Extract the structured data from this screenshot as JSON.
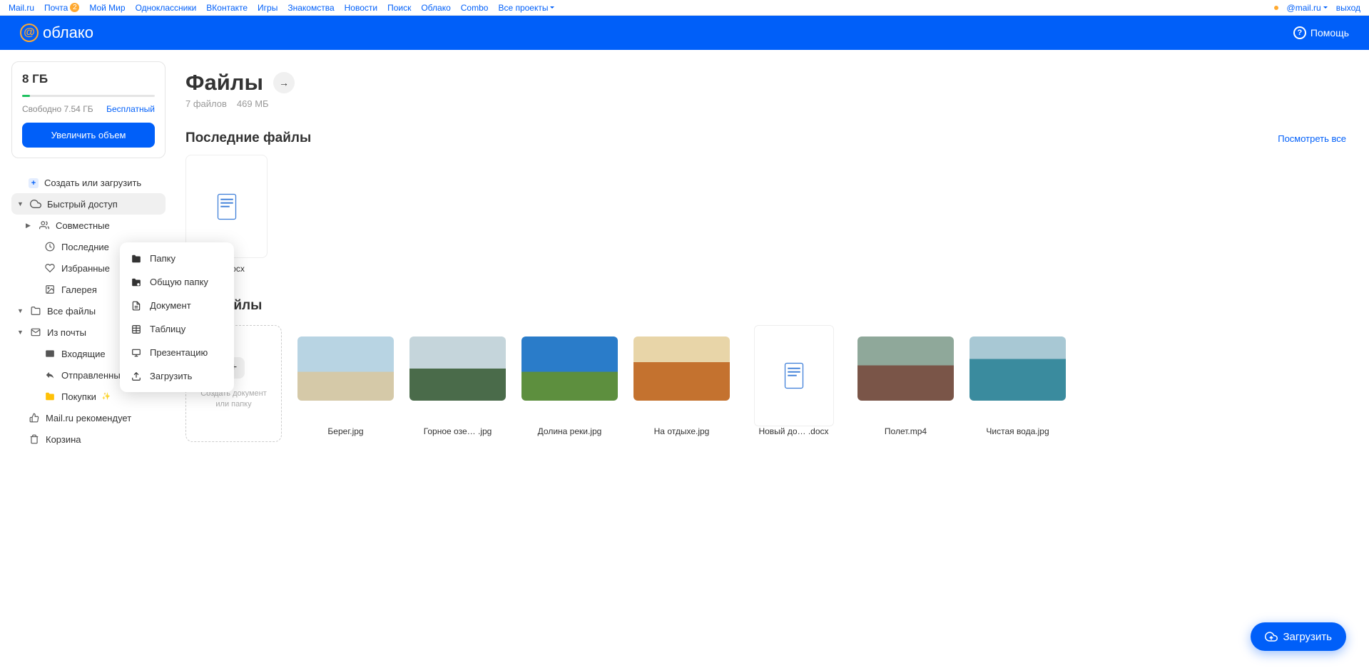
{
  "topnav": {
    "left": [
      {
        "label": "Mail.ru"
      },
      {
        "label": "Почта",
        "badge": "2"
      },
      {
        "label": "Мой Мир"
      },
      {
        "label": "Одноклассники"
      },
      {
        "label": "ВКонтакте"
      },
      {
        "label": "Игры"
      },
      {
        "label": "Знакомства"
      },
      {
        "label": "Новости"
      },
      {
        "label": "Поиск"
      },
      {
        "label": "Облако"
      },
      {
        "label": "Combo"
      },
      {
        "label": "Все проекты",
        "dropdown": true
      }
    ],
    "email": "@mail.ru",
    "logout": "выход"
  },
  "header": {
    "logo_text": "облако",
    "help": "Помощь"
  },
  "storage": {
    "size": "8 ГБ",
    "free_label": "Свободно 7.54 ГБ",
    "plan": "Бесплатный",
    "button": "Увеличить объем"
  },
  "sidebar": {
    "create": "Создать или загрузить",
    "quick": "Быстрый доступ",
    "shared": "Совместные",
    "recent": "Последние",
    "favorites": "Избранные",
    "gallery": "Галерея",
    "allfiles": "Все файлы",
    "frommail": "Из почты",
    "inbox": "Входящие",
    "sent": "Отправленные",
    "purchases": "Покупки",
    "recommends": "Mail.ru рекомендует",
    "trash": "Корзина"
  },
  "create_menu": {
    "folder": "Папку",
    "shared_folder": "Общую папку",
    "document": "Документ",
    "table": "Таблицу",
    "presentation": "Презентацию",
    "upload": "Загрузить"
  },
  "main": {
    "title": "Файлы",
    "sub_count": "7 файлов",
    "sub_size": "469 МБ",
    "recent_title": "Последние файлы",
    "view_all": "Посмотреть все",
    "all_files_title": "Все файлы",
    "add_caption": "Создать документ или папку",
    "recent_items": [
      {
        "name": "о… .docx"
      }
    ],
    "files": [
      {
        "name": "Берег.jpg",
        "thumb_class": "th1"
      },
      {
        "name": "Горное озе… .jpg",
        "thumb_class": "th2"
      },
      {
        "name": "Долина реки.jpg",
        "thumb_class": "th3"
      },
      {
        "name": "На отдыхе.jpg",
        "thumb_class": "th4"
      },
      {
        "name": "Новый до… .docx",
        "is_doc": true
      },
      {
        "name": "Полет.mp4",
        "thumb_class": "th6"
      },
      {
        "name": "Чистая вода.jpg",
        "thumb_class": "th7"
      }
    ]
  },
  "fab": "Загрузить"
}
